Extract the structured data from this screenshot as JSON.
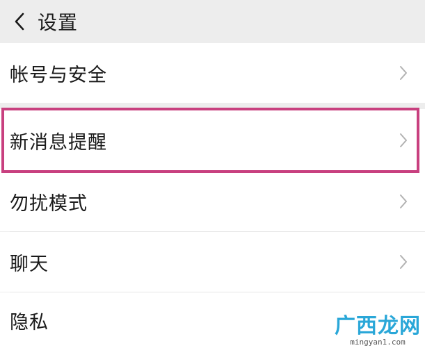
{
  "header": {
    "title": "设置",
    "back_icon": "chevron-left-icon"
  },
  "settings": {
    "items": [
      {
        "label": "帐号与安全"
      },
      {
        "label": "新消息提醒",
        "highlighted": true
      },
      {
        "label": "勿扰模式"
      },
      {
        "label": "聊天"
      },
      {
        "label": "隐私"
      }
    ]
  },
  "watermark": {
    "title": "广西龙网",
    "sub": "mingyan1.com"
  },
  "colors": {
    "background": "#ededed",
    "row": "#ffffff",
    "highlight_border": "#c8407f",
    "chevron": "#b2b2b2",
    "watermark": "#2aa7d8"
  }
}
